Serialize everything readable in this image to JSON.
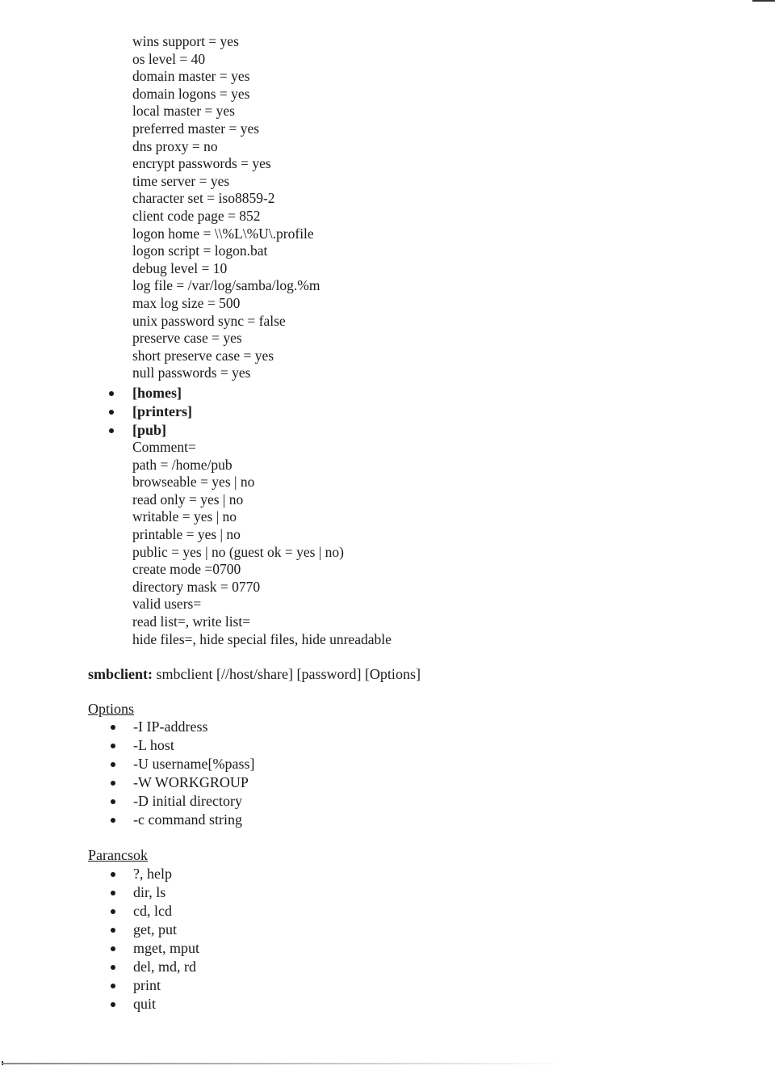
{
  "global_settings": [
    "wins support = yes",
    "os level = 40",
    "domain master = yes",
    "domain logons = yes",
    "local master = yes",
    "preferred master = yes",
    "dns proxy = no",
    "encrypt passwords = yes",
    "time server = yes",
    "character set = iso8859-2",
    "client code page = 852",
    "logon home = \\\\%L\\%U\\.profile",
    "logon script = logon.bat",
    "debug level = 10",
    "log file = /var/log/samba/log.%m",
    "max log size = 500",
    "unix password sync = false",
    "preserve case = yes",
    "short preserve case = yes",
    "null passwords = yes"
  ],
  "sections": [
    "[homes]",
    "[printers]",
    "[pub]"
  ],
  "pub_settings": [
    "Comment=",
    "path = /home/pub",
    "browseable = yes | no",
    "read only = yes | no",
    "writable = yes | no",
    "printable = yes | no",
    "public = yes | no (guest ok = yes | no)",
    "create mode =0700",
    "directory mask = 0770",
    "valid users=",
    "read list=, write list=",
    "hide files=, hide special files, hide unreadable"
  ],
  "smbclient": {
    "label": "smbclient:",
    "syntax": " smbclient [//host/share] [password] [Options]"
  },
  "options": {
    "heading": "Options",
    "items": [
      "-I IP-address",
      "-L host",
      "-U username[%pass]",
      "-W WORKGROUP",
      "-D initial directory",
      "-c command string"
    ]
  },
  "commands": {
    "heading": "Parancsok",
    "items": [
      "?, help",
      "dir, ls",
      "cd, lcd",
      "get, put",
      "mget, mput",
      "del, md, rd",
      "print",
      "quit"
    ]
  }
}
